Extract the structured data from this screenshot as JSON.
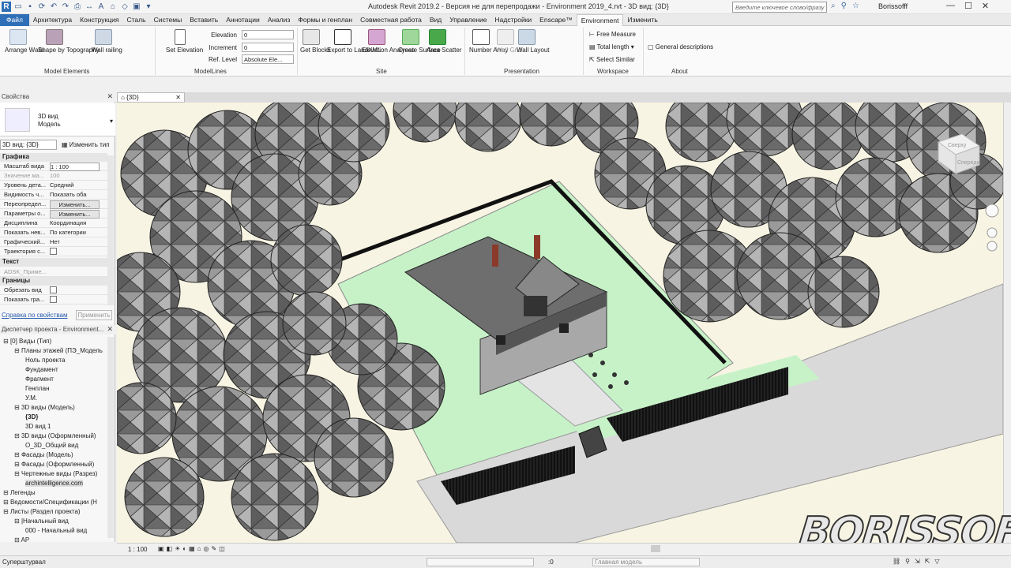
{
  "app": {
    "title": "Autodesk Revit 2019.2 - Версия не для перепродажи - Environment 2019_4.rvt - 3D вид: {3D}",
    "search_placeholder": "Введите ключевое слово/фразу",
    "user": "Borissofff"
  },
  "tabs": [
    "Файл",
    "Архитектура",
    "Конструкция",
    "Сталь",
    "Системы",
    "Вставить",
    "Аннотации",
    "Анализ",
    "Формы и генплан",
    "Совместная работа",
    "Вид",
    "Управление",
    "Надстройки",
    "Enscape™",
    "Environment",
    "Изменить"
  ],
  "active_tab": "Environment",
  "ribbon": {
    "model_elements": {
      "label": "Model Elements",
      "buttons": [
        "Arrange Walls",
        "Shape by Topography",
        "Wall railing"
      ]
    },
    "modellines": {
      "label": "ModelLines",
      "set_elevation": "Set Elevation",
      "elevation_label": "Elevation",
      "elevation_value": "0",
      "increment_label": "Increment",
      "increment_value": "0",
      "ref_label": "Ref. Level",
      "ref_value": "Absolute Ele..."
    },
    "site": {
      "label": "Site",
      "buttons": [
        "Get Blocks",
        "Export to LandXML",
        "Elevation Analyses",
        "Create Surface",
        "Area Scatter"
      ]
    },
    "presentation": {
      "label": "Presentation",
      "buttons": [
        "Number Array",
        "Wall Grid",
        "Wall Layout"
      ]
    },
    "workspace": {
      "label": "Workspace",
      "items": [
        "Free Measure",
        "Total length",
        "Select Similar"
      ]
    },
    "about": {
      "label": "About",
      "item": "General  descriptions"
    }
  },
  "properties": {
    "title": "Свойства",
    "type_name": "3D вид",
    "type_sub": "Модель",
    "selector": "3D вид: {3D}",
    "edit_type": "Изменить тип",
    "section_graphics": "Графика",
    "rows": [
      {
        "k": "Масштаб вида",
        "v": "1 : 100"
      },
      {
        "k": "Значение ма...",
        "v": "100"
      },
      {
        "k": "Уровень дета...",
        "v": "Средний"
      },
      {
        "k": "Видимость ч...",
        "v": "Показать оба"
      },
      {
        "k": "Переопредел...",
        "v": "Изменить..."
      },
      {
        "k": "Параметры о...",
        "v": "Изменить..."
      },
      {
        "k": "Дисциплина",
        "v": "Координация"
      },
      {
        "k": "Показать нев...",
        "v": "По категории"
      },
      {
        "k": "Графический...",
        "v": "Нет"
      },
      {
        "k": "Траектория с...",
        "v": ""
      }
    ],
    "section_text": "Текст",
    "text_row": "ADSK_Приме...",
    "section_bounds": "Границы",
    "bound_rows": [
      "Обрезать вид",
      "Показать гра..."
    ],
    "help_link": "Справка по свойствам",
    "apply": "Применить"
  },
  "browser": {
    "title": "Диспетчер проекта - Environment...",
    "items": [
      {
        "t": "[0] Виды (Тип)",
        "lvl": 0
      },
      {
        "t": "Планы этажей (ПЭ_Модель",
        "lvl": 1
      },
      {
        "t": "Ноль проекта",
        "lvl": 2
      },
      {
        "t": "Фундамент",
        "lvl": 2
      },
      {
        "t": "Фрагмент",
        "lvl": 2
      },
      {
        "t": "Генплан",
        "lvl": 2
      },
      {
        "t": "У.М.",
        "lvl": 2
      },
      {
        "t": "3D виды (Модель)",
        "lvl": 1
      },
      {
        "t": "{3D}",
        "lvl": 2
      },
      {
        "t": "3D вид 1",
        "lvl": 2
      },
      {
        "t": "3D виды (Оформленный)",
        "lvl": 1
      },
      {
        "t": "O_3D_Общий вид",
        "lvl": 2
      },
      {
        "t": "Фасады (Модель)",
        "lvl": 1
      },
      {
        "t": "Фасады (Оформленный)",
        "lvl": 1
      },
      {
        "t": "Чертежные виды (Разрез)",
        "lvl": 1
      },
      {
        "t": "archintelligence.com",
        "lvl": 2
      },
      {
        "t": "Легенды",
        "lvl": 0
      },
      {
        "t": "Ведомости/Спецификации (Н",
        "lvl": 0
      },
      {
        "t": "Листы (Раздел проекта)",
        "lvl": 0
      },
      {
        "t": "|Начальный вид",
        "lvl": 1
      },
      {
        "t": "000 - Начальный вид",
        "lvl": 2
      },
      {
        "t": "AP",
        "lvl": 1
      }
    ]
  },
  "view": {
    "tab": "{3D}",
    "scale": "1 : 100",
    "viewcube_top": "Сверху",
    "viewcube_front": "Спереди"
  },
  "status": {
    "left": "Суперштурвал",
    "zero": ":0",
    "model": "Главная модель"
  },
  "watermark": "BORISSOFF",
  "colors": {
    "accent": "#2e6fb7",
    "lawn": "#c7f2c8",
    "ground": "#f8f4e3",
    "tree": "#6b6b6b"
  }
}
